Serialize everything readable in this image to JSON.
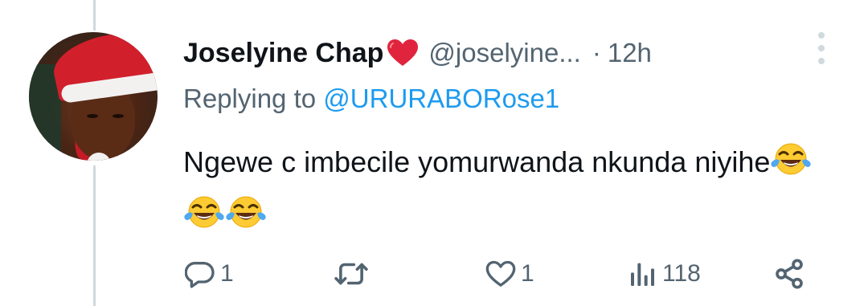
{
  "tweet": {
    "display_name": "Joselyine Chap",
    "handle": "@joselyine...",
    "separator": "·",
    "time": "12h",
    "replying_prefix": "Replying to",
    "reply_to_handle": "@URURABORose1",
    "text": "Ngewe c imbecile yomurwanda nkunda niyihe",
    "emojis": [
      "face-with-tears-of-joy",
      "face-with-tears-of-joy",
      "face-with-tears-of-joy"
    ]
  },
  "actions": {
    "reply_count": "1",
    "retweet_count": "",
    "like_count": "1",
    "views_count": "118"
  },
  "icons": {
    "heart_emoji": "red-heart",
    "more": "more-vertical-icon",
    "reply": "comment-icon",
    "retweet": "retweet-icon",
    "like": "heart-outline-icon",
    "views": "analytics-icon",
    "share": "share-icon"
  },
  "colors": {
    "text": "#0f1419",
    "secondary": "#536471",
    "link": "#1d9bf0",
    "heart": "#e0243d"
  }
}
